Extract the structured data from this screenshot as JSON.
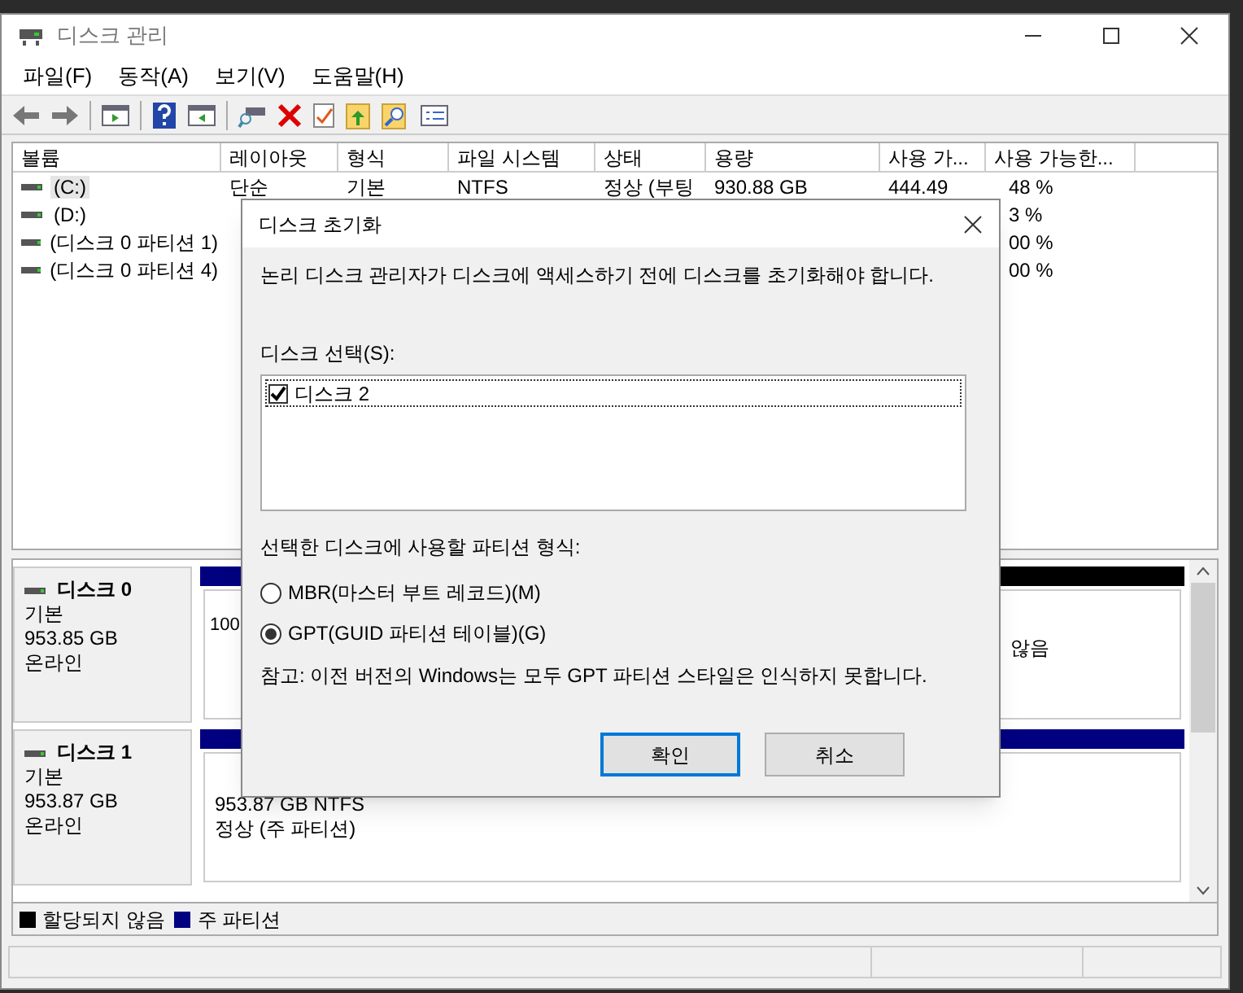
{
  "window": {
    "title": "디스크 관리"
  },
  "menu": [
    "파일(F)",
    "동작(A)",
    "보기(V)",
    "도움말(H)"
  ],
  "volume_table": {
    "columns": [
      "볼륨",
      "레이아웃",
      "형식",
      "파일 시스템",
      "상태",
      "용량",
      "사용 가...",
      "사용 가능한..."
    ],
    "rows": [
      {
        "cells": [
          "(C:)",
          "단순",
          "기본",
          "NTFS",
          "정상 (부팅",
          "930.88 GB",
          "444.49",
          "48 %"
        ],
        "selected": true
      },
      {
        "cells": [
          "(D:)",
          "",
          "",
          "",
          "",
          "",
          "",
          "3 %"
        ],
        "selected": false
      },
      {
        "cells": [
          "(디스크 0 파티션 1)",
          "",
          "",
          "",
          "",
          "",
          "",
          "00 %"
        ],
        "selected": false
      },
      {
        "cells": [
          "(디스크 0 파티션 4)",
          "",
          "",
          "",
          "",
          "",
          "",
          "00 %"
        ],
        "selected": false
      }
    ]
  },
  "disks": [
    {
      "name": "디스크 0",
      "type": "기본",
      "size": "953.85 GB",
      "status": "온라인",
      "partitions": [
        {
          "kind": "primary",
          "lines": [
            "100"
          ]
        },
        {
          "kind": "unallocated",
          "lines": [
            "않음"
          ]
        }
      ]
    },
    {
      "name": "디스크 1",
      "type": "기본",
      "size": "953.87 GB",
      "status": "온라인",
      "partitions": [
        {
          "kind": "primary",
          "lines": [
            "953.87 GB NTFS",
            "정상 (주 파티션)"
          ]
        }
      ]
    }
  ],
  "legend": [
    {
      "label": "할당되지 않음",
      "color": "#000000"
    },
    {
      "label": "주 파티션",
      "color": "#000080"
    }
  ],
  "dialog": {
    "title": "디스크 초기화",
    "message": "논리 디스크 관리자가 디스크에 액세스하기 전에 디스크를 초기화해야 합니다.",
    "select_label": "디스크 선택(S):",
    "disks": [
      {
        "label": "디스크 2",
        "checked": true
      }
    ],
    "style_label": "선택한 디스크에 사용할 파티션 형식:",
    "styles": [
      {
        "label": "MBR(마스터 부트 레코드)(M)",
        "selected": false
      },
      {
        "label": "GPT(GUID 파티션 테이블)(G)",
        "selected": true
      }
    ],
    "note": "참고: 이전 버전의 Windows는 모두 GPT 파티션 스타일은 인식하지 못합니다.",
    "buttons": [
      {
        "label": "확인",
        "default": true
      },
      {
        "label": "취소",
        "default": false
      }
    ]
  }
}
